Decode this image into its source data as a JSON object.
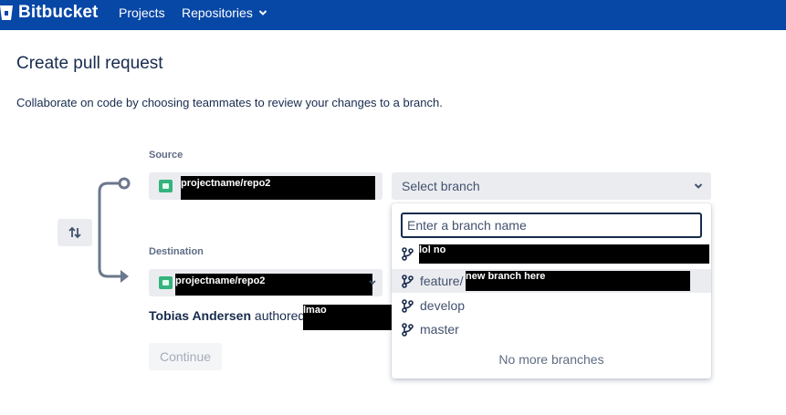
{
  "header": {
    "brand": "Bitbucket",
    "nav": {
      "projects": "Projects",
      "repositories": "Repositories"
    }
  },
  "page": {
    "title": "Create pull request",
    "subtitle": "Collaborate on code by choosing teammates to review your changes to a branch."
  },
  "source": {
    "label": "Source",
    "repo": "projectname/repo2",
    "branch_placeholder": "Select branch"
  },
  "destination": {
    "label": "Destination",
    "repo": "projectname/repo2"
  },
  "author": {
    "name": "Tobias Andersen",
    "verb": "authored",
    "redacted": "lmao"
  },
  "continue_label": "Continue",
  "dropdown": {
    "input_placeholder": "Enter a branch name",
    "branches": [
      {
        "prefix": "",
        "redacted": "lol no"
      },
      {
        "prefix": "feature/",
        "redacted": "new branch here"
      },
      {
        "prefix": "develop",
        "redacted": ""
      },
      {
        "prefix": "master",
        "redacted": ""
      }
    ],
    "footer": "No more branches"
  },
  "icons": {
    "logo": "bitbucket-logo-icon",
    "repo": "repository-folder-icon",
    "branch": "branch-icon",
    "swap": "swap-arrows-icon",
    "chevron": "chevron-down-icon"
  },
  "colors": {
    "header_bg": "#0747a6",
    "repo_icon": "#36b37e"
  }
}
